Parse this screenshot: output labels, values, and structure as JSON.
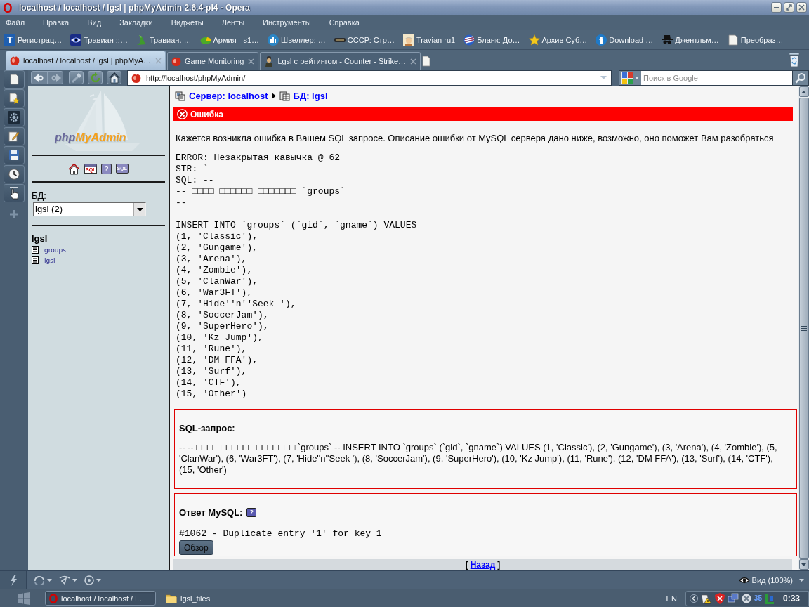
{
  "window": {
    "title": "localhost / localhost / lgsl | phpMyAdmin 2.6.4-pl4 - Opera"
  },
  "menu": [
    "Файл",
    "Правка",
    "Вид",
    "Закладки",
    "Виджеты",
    "Ленты",
    "Инструменты",
    "Справка"
  ],
  "bookmarks": [
    {
      "label": "Регистрац…",
      "badge": "T"
    },
    {
      "label": "Травиан ::…"
    },
    {
      "label": "Травиан. …"
    },
    {
      "label": "Армия - s1…"
    },
    {
      "label": "Швеллер: …"
    },
    {
      "label": "СССР: Стр…"
    },
    {
      "label": "Travian ru1"
    },
    {
      "label": "Бланк: До…"
    },
    {
      "label": "Архив Суб…"
    },
    {
      "label": "Download …"
    },
    {
      "label": "Джентльм…"
    },
    {
      "label": "Преобраз…"
    }
  ],
  "tabs": [
    {
      "title": "localhost / localhost / lgsl | phpMyA…",
      "selected": true
    },
    {
      "title": "Game Monitoring",
      "selected": false
    },
    {
      "title": "Lgsl с рейтингом - Counter - Strike…",
      "selected": false
    }
  ],
  "address_bar": {
    "url": "http://localhost/phpMyAdmin/"
  },
  "search": {
    "placeholder": "Поиск в Google"
  },
  "sidebar": {
    "logo": [
      "php",
      "MyAdmin"
    ],
    "links": {
      "query_window": "SQL",
      "help": "?",
      "sql_docs": "SQL"
    },
    "db_label": "БД:",
    "db_select": "lgsl (2)",
    "db_name": "lgsl",
    "tables": [
      "groups",
      "lgsl"
    ]
  },
  "main": {
    "breadcrumb": [
      "Сервер: localhost",
      "БД: lgsl"
    ],
    "error_title": "Ошибка",
    "message": "Кажется возникла ошибка в Вашем SQL запросе. Описание ошибки от MySQL сервера дано ниже, возможно, оно поможет Вам разобраться",
    "error_report": [
      "ERROR: Незакрытая кавычка @ 62",
      "STR: `",
      "SQL: --",
      "-- □□□□ □□□□□□ □□□□□□□ `groups`",
      "--"
    ],
    "sql_dump": [
      "INSERT INTO `groups` (`gid`, `gname`) VALUES",
      "(1, 'Classic'),",
      "(2, 'Gungame'),",
      "(3, 'Arena'),",
      "(4, 'Zombie'),",
      "(5, 'ClanWar'),",
      "(6, 'War3FT'),",
      "(7, 'Hide''n''Seek '),",
      "(8, 'SoccerJam'),",
      "(9, 'SuperHero'),",
      "(10, 'Kz Jump'),",
      "(11, 'Rune'),",
      "(12, 'DM FFA'),",
      "(13, 'Surf'),",
      "(14, 'CTF'),",
      "(15, 'Other')"
    ],
    "sql_query": {
      "title": "SQL-запрос:",
      "text": "-- -- □□□□ □□□□□□ □□□□□□□ `groups` -- INSERT INTO `groups` (`gid`, `gname`) VALUES (1, 'Classic'), (2, 'Gungame'), (3, 'Arena'), (4, 'Zombie'), (5, 'ClanWar'), (6, 'War3FT'), (7, 'Hide''n''Seek '), (8, 'SoccerJam'), (9, 'SuperHero'), (10, 'Kz Jump'), (11, 'Rune'), (12, 'DM FFA'), (13, 'Surf'), (14, 'CTF'), (15, 'Other')"
    },
    "mysql_response": {
      "title": "Ответ MySQL:",
      "help": "?",
      "text": "#1062 - Duplicate entry '1' for key 1",
      "button": "Обзор"
    },
    "back_link": {
      "open": "[",
      "label": "Назад",
      "close": "]"
    }
  },
  "status_bar": {
    "zoom": "Вид (100%)"
  },
  "taskbar": {
    "buttons": [
      {
        "label": "localhost / localhost / l…",
        "selected": true
      },
      {
        "label": "lgsl_files",
        "selected": false
      }
    ],
    "language": "EN",
    "tray_counter": "35",
    "clock": "0:33"
  }
}
